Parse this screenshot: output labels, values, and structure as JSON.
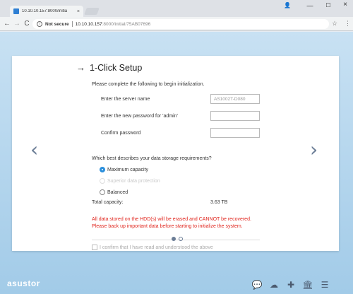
{
  "browser": {
    "tab_title": "10.10.10.157:8000/initia",
    "tab_close": "×",
    "address": {
      "security_label": "Not secure",
      "host": "10.10.10.157",
      "path": ":8000/initial/75AB07696"
    },
    "icons": {
      "back": "←",
      "forward": "→",
      "reload": "C",
      "star": "☆",
      "menu": "⋮",
      "profile": "👤",
      "minimize": "—",
      "maximize": "☐",
      "close": "×"
    }
  },
  "wizard": {
    "heading_arrow": "→",
    "title": "1-Click Setup",
    "intro": "Please complete the following to begin initialization.",
    "server_name_label": "Enter the server name",
    "server_name_value": "AS1002T-D080",
    "password_label": "Enter the new password for 'admin'",
    "password_value": "",
    "confirm_label": "Confirm password",
    "confirm_value": "",
    "storage_question": "Which best describes your data storage requirements?",
    "options": [
      {
        "label": "Maximum capacity",
        "checked": true,
        "disabled": false
      },
      {
        "label": "Superior data protection",
        "checked": false,
        "disabled": true
      },
      {
        "label": "Balanced",
        "checked": false,
        "disabled": false
      }
    ],
    "total_capacity_label": "Total capacity:",
    "total_capacity_value": "3.63 TB",
    "warning_line1": "All data stored on the HDD(s) will be erased and CANNOT be recovered.",
    "warning_line2": "Please back up important data before starting to initialize the system.",
    "confirm_checkbox_label": "I confirm that I have read and understood the above",
    "prev_arrow": "‹",
    "next_arrow": "›",
    "pages": {
      "current": 1,
      "total": 2
    }
  },
  "footer": {
    "logo": "asustor",
    "icons": [
      "chat-icon",
      "cloud-download-icon",
      "puzzle-icon",
      "museum-icon",
      "menu-icon"
    ],
    "icon_glyphs": [
      "💬",
      "☁",
      "✚",
      "🏛",
      "☰"
    ]
  },
  "colors": {
    "accent": "#2b8fdc",
    "warning": "#e0231b",
    "page_top": "#c8e1f3",
    "page_bottom": "#a2cbe8"
  }
}
